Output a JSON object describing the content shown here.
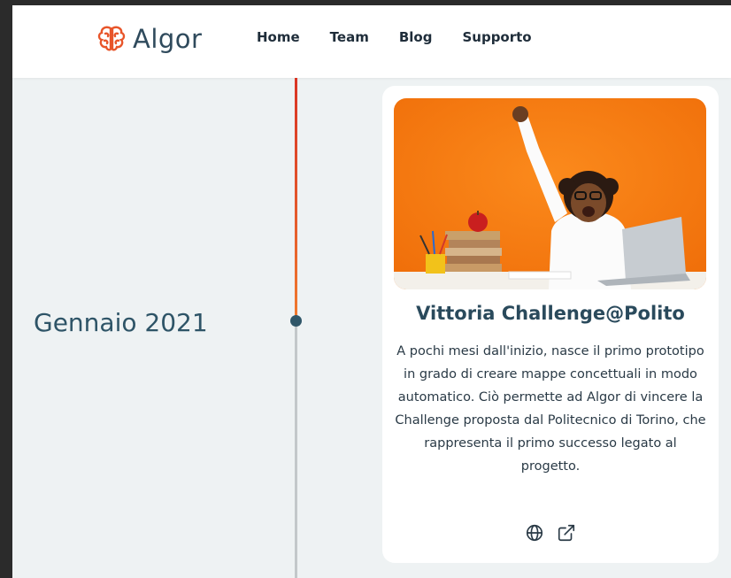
{
  "brand": {
    "name": "Algor",
    "icon": "brain-icon"
  },
  "nav": {
    "items": [
      {
        "label": "Home"
      },
      {
        "label": "Team"
      },
      {
        "label": "Blog"
      },
      {
        "label": "Supporto"
      }
    ]
  },
  "timeline": {
    "date": "Gennaio 2021"
  },
  "card": {
    "image": "girl-celebrating-at-laptop-photo",
    "title": "Vittoria Challenge@Polito",
    "description": "A pochi mesi dall'inizio, nasce il primo prototipo in grado di creare mappe concettuali in modo automatico. Ciò permette ad Algor di vincere la Challenge proposta dal Politecnico di Torino, che rappresenta il primo successo legato al progetto.",
    "links": [
      {
        "icon": "globe-icon"
      },
      {
        "icon": "external-link-icon"
      }
    ]
  },
  "colors": {
    "accent": "#e8552a",
    "primary_text": "#2e5467",
    "background": "#eef2f3"
  }
}
